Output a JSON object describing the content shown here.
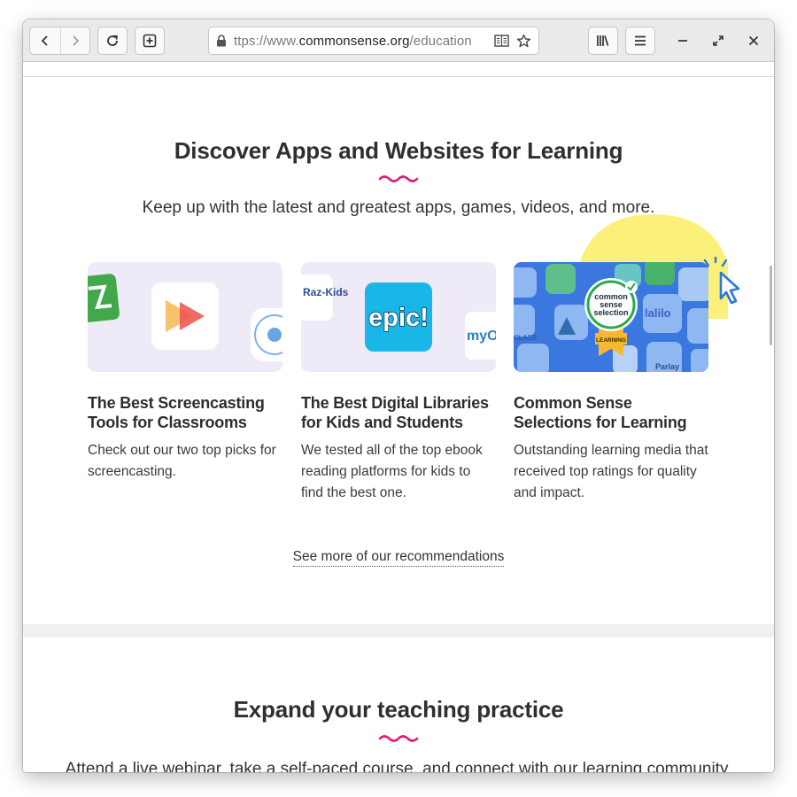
{
  "browser": {
    "url_prefix": "ttps://www.",
    "url_host": "commonsense.org",
    "url_path": "/education"
  },
  "discover": {
    "title": "Discover Apps and Websites for Learning",
    "subtitle": "Keep up with the latest and greatest apps, games, videos, and more.",
    "cards": [
      {
        "title": "The Best Screencasting Tools for Classrooms",
        "description": "Check out our two top picks for screencasting."
      },
      {
        "title": "The Best Digital Libraries for Kids and Students",
        "description": "We tested all of the top ebook reading platforms for kids to find the best one.",
        "logo_text": "epic!",
        "side_left": "Raz-Kids",
        "side_right": "myO"
      },
      {
        "title": "Common Sense Selections for Learning",
        "description": "Outstanding learning media that received top ratings for quality and impact.",
        "badge_line1": "common",
        "badge_line2": "sense",
        "badge_line3": "selection",
        "ribbon": "LEARNING",
        "tile_lalilo": "lalilo",
        "tile_parlay": "Parlay",
        "tile_class": "CLASS"
      }
    ],
    "more_link": "See more of our recommendations"
  },
  "teaching": {
    "title": "Expand your teaching practice",
    "subtitle": "Attend a live webinar, take a self-paced course, and connect with our learning community."
  },
  "colors": {
    "accent_pink": "#e0197d",
    "card_bg": "#efeaf7",
    "selection_blue": "#3a78e0",
    "highlight_yellow": "#fbf07a"
  }
}
